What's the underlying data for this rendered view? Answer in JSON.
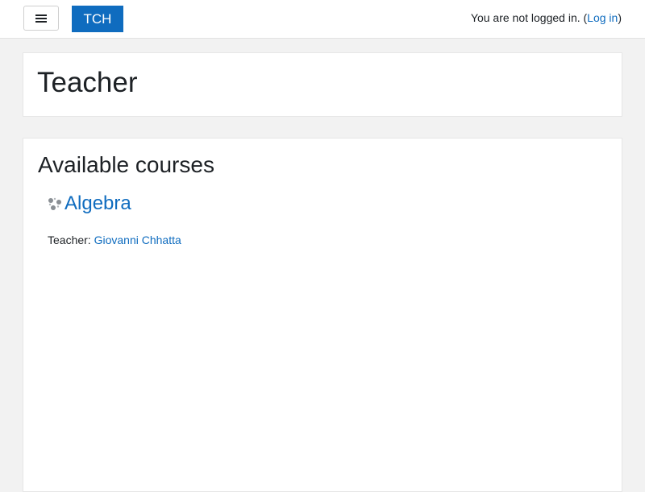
{
  "navbar": {
    "menu_icon": "hamburger-icon",
    "brand_label": "TCH",
    "login_prefix": "You are not logged in. (",
    "login_link": "Log in",
    "login_suffix": ")"
  },
  "header": {
    "title": "Teacher"
  },
  "main": {
    "section_title": "Available courses",
    "courses": [
      {
        "icon": "course-icon",
        "name": "Algebra",
        "teacher_label": "Teacher: ",
        "teacher_name": "Giovanni Chhatta"
      }
    ]
  },
  "colors": {
    "accent": "#0f6cbf",
    "background": "#f2f2f2",
    "card": "#ffffff",
    "text": "#1d2125"
  }
}
